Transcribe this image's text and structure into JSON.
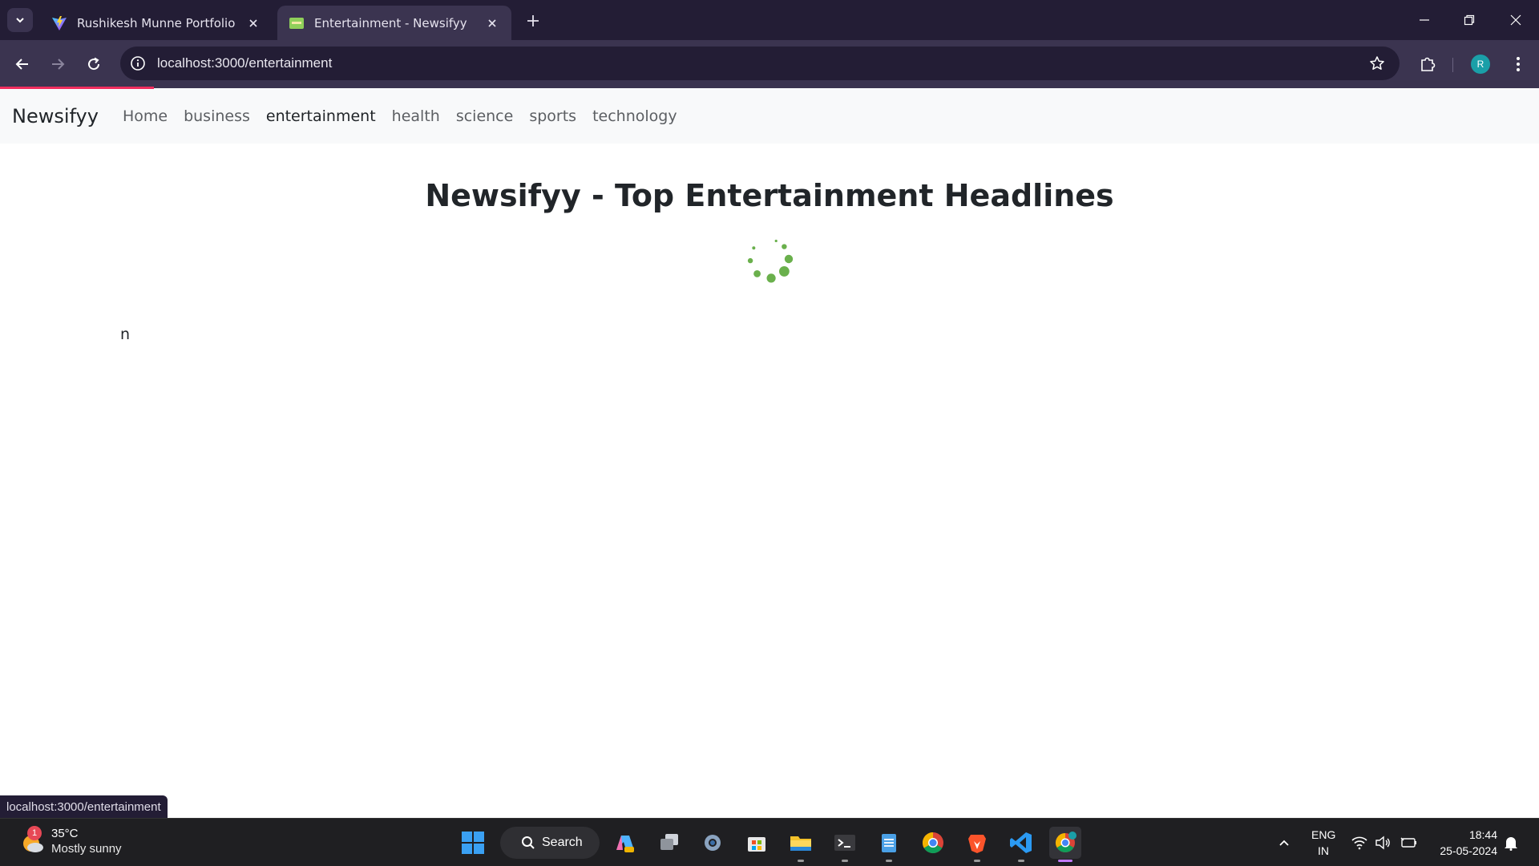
{
  "browser": {
    "tabs": [
      {
        "title": "Rushikesh Munne Portfolio",
        "active": false
      },
      {
        "title": "Entertainment - Newsifyy",
        "active": true
      }
    ],
    "url": "localhost:3000/entertainment",
    "profile_initial": "R",
    "status_url": "localhost:3000/entertainment",
    "loading_bar_color": "#f02d5e"
  },
  "site": {
    "brand": "Newsifyy",
    "nav": [
      {
        "label": "Home",
        "active": false
      },
      {
        "label": "business",
        "active": false
      },
      {
        "label": "entertainment",
        "active": true
      },
      {
        "label": "health",
        "active": false
      },
      {
        "label": "science",
        "active": false
      },
      {
        "label": "sports",
        "active": false
      },
      {
        "label": "technology",
        "active": false
      }
    ],
    "heading": "Newsifyy - Top Entertainment Headlines",
    "stray_text": "n",
    "spinner_color": "#6ab04c"
  },
  "taskbar": {
    "weather": {
      "temp": "35°C",
      "condition": "Mostly sunny",
      "badge": "1"
    },
    "search_label": "Search",
    "language": {
      "line1": "ENG",
      "line2": "IN"
    },
    "clock": {
      "time": "18:44",
      "date": "25-05-2024"
    }
  }
}
